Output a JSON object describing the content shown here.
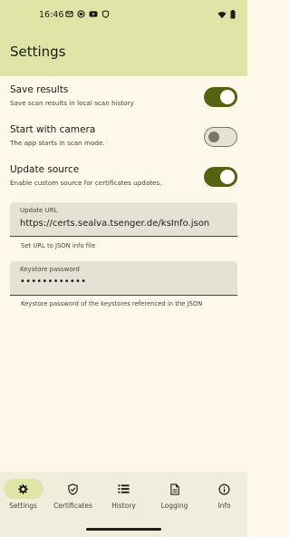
{
  "status_bar": {
    "time": "16:46",
    "left_icons": [
      "mail-icon",
      "app-icon",
      "youtube-icon",
      "shield-icon"
    ],
    "right_icons": [
      "wifi-icon",
      "battery-icon"
    ]
  },
  "app_bar": {
    "title": "Settings"
  },
  "settings": {
    "save_results": {
      "title": "Save results",
      "description": "Save scan results in local scan history",
      "enabled": true
    },
    "start_with_camera": {
      "title": "Start with camera",
      "description": "The app starts in scan mode.",
      "enabled": false
    },
    "update_source": {
      "title": "Update source",
      "description": "Enable custom source for certificates updates.",
      "enabled": true
    }
  },
  "update_url": {
    "label": "Update URL",
    "value": "https://certs.sealva.tsenger.de/ksInfo.json",
    "helper": "Set URL to JSON info file"
  },
  "keystore_password": {
    "label": "Keystore password",
    "value": "••••••••••••",
    "helper": "Keystore password of the keystores referenced in the JSON"
  },
  "bottom_nav": {
    "active": "Settings",
    "items": [
      {
        "label": "Settings",
        "icon": "gear-icon"
      },
      {
        "label": "Certificates",
        "icon": "certificate-icon"
      },
      {
        "label": "History",
        "icon": "list-icon"
      },
      {
        "label": "Logging",
        "icon": "document-icon"
      },
      {
        "label": "Info",
        "icon": "info-icon"
      }
    ]
  },
  "colors": {
    "primary": "#566210",
    "app_bar": "#dfe5a6",
    "background": "#fdf8e9",
    "field": "#e5e2d5"
  }
}
